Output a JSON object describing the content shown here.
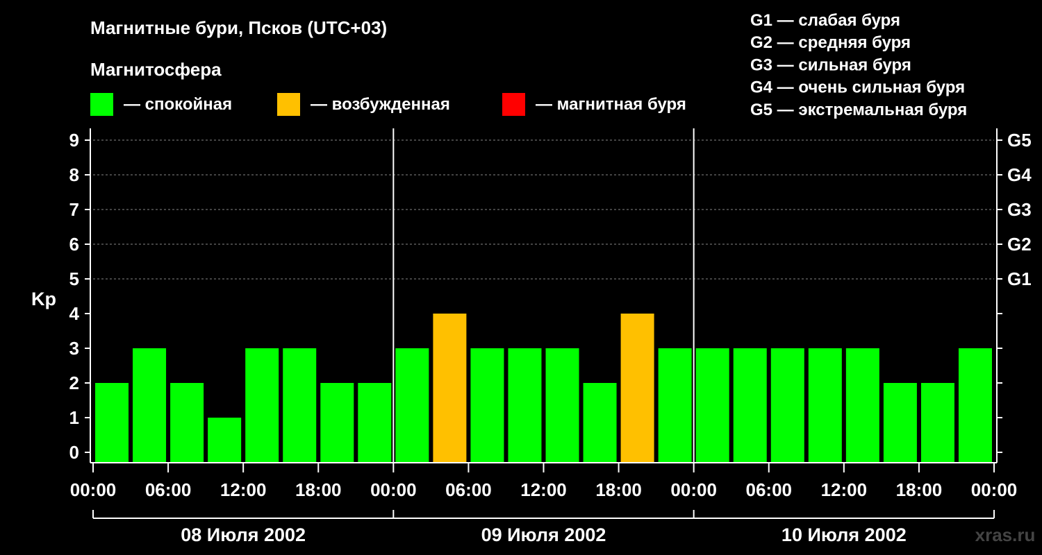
{
  "chart_data": {
    "type": "bar",
    "title": "Магнитные бури, Псков (UTC+03)",
    "subtitle": "Магнитосфера",
    "ylabel": "Kp",
    "ylim": [
      0,
      9
    ],
    "yticks": [
      "0",
      "1",
      "2",
      "3",
      "4",
      "5",
      "6",
      "7",
      "8",
      "9"
    ],
    "right_ticks": [
      {
        "kp": 5,
        "label": "G1"
      },
      {
        "kp": 6,
        "label": "G2"
      },
      {
        "kp": 7,
        "label": "G3"
      },
      {
        "kp": 8,
        "label": "G4"
      },
      {
        "kp": 9,
        "label": "G5"
      }
    ],
    "legend": [
      {
        "label": "— спокойная",
        "color": "#00ff00"
      },
      {
        "label": "— возбужденная",
        "color": "#ffc000"
      },
      {
        "label": "— магнитная буря",
        "color": "#ff0000"
      }
    ],
    "storm_scale": [
      "G1 — слабая буря",
      "G2 — средняя буря",
      "G3 — сильная буря",
      "G4 — очень сильная буря",
      "G5 — экстремальная буря"
    ],
    "days": [
      "08 Июля 2002",
      "09 Июля 2002",
      "10 Июля 2002"
    ],
    "xtick_labels": [
      "00:00",
      "06:00",
      "12:00",
      "18:00",
      "00:00",
      "06:00",
      "12:00",
      "18:00",
      "00:00",
      "06:00",
      "12:00",
      "18:00",
      "00:00"
    ],
    "values": [
      2,
      3,
      2,
      1,
      3,
      3,
      2,
      2,
      3,
      4,
      3,
      3,
      3,
      2,
      4,
      3,
      3,
      3,
      3,
      3,
      3,
      2,
      2,
      3
    ],
    "colors": {
      "quiet": "#00ff00",
      "active": "#ffc000",
      "storm": "#ff0000"
    },
    "grid": "dashed at Kp 5–9",
    "watermark": "xras.ru"
  }
}
